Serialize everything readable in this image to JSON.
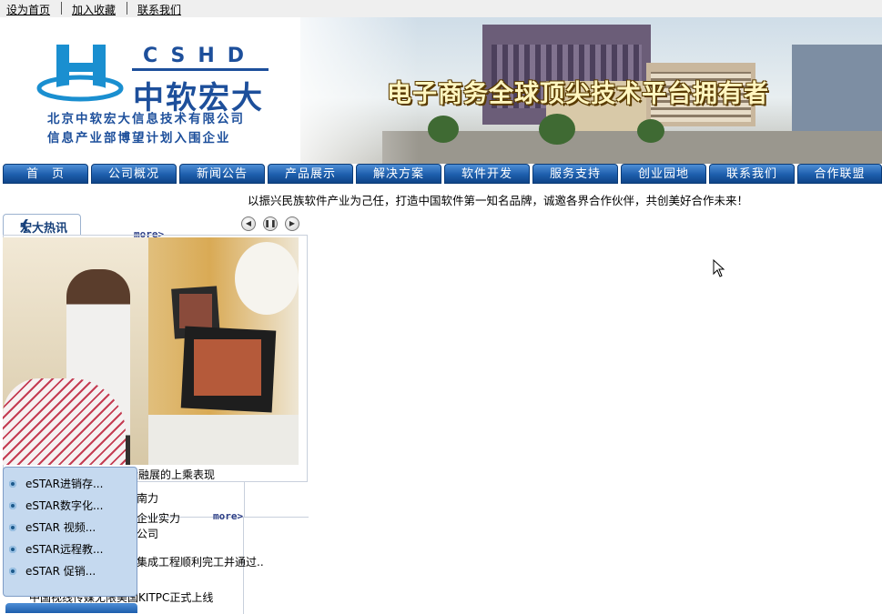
{
  "top_links": [
    "设为首页",
    "加入收藏",
    "联系我们"
  ],
  "brand": {
    "logo_letters": "CSHD",
    "logo_name": "中软宏大",
    "company_line1": "北京中软宏大信息技术有限公司",
    "company_line2": "信息产业部博望计划入围企业",
    "slogan": "电子商务全球顶尖技术平台拥有者"
  },
  "nav": [
    "首　页",
    "公司概况",
    "新闻公告",
    "产品展示",
    "解决方案",
    "软件开发",
    "服务支持",
    "创业园地",
    "联系我们",
    "合作联盟"
  ],
  "marquee": "以振兴民族软件产业为己任，打造中国软件第一知名品牌，诚邀各界合作伙伴，共创美好合作未来！",
  "news_panel": {
    "tab_label": "宏大热讯",
    "more_label": "more>",
    "controls": [
      "prev-icon",
      "pause-icon",
      "next-icon"
    ]
  },
  "news_items": [
    "促销系统在金融展的上乘表现",
    "南力",
    "企业实力",
    "公司",
    "集成工程顺利完工并通过..",
    "中国视线传媒无限美国KITPC正式上线"
  ],
  "product_menu": [
    "eSTAR进销存...",
    "eSTAR数字化...",
    "eSTAR 视频...",
    "eSTAR远程教...",
    "eSTAR 促销..."
  ]
}
